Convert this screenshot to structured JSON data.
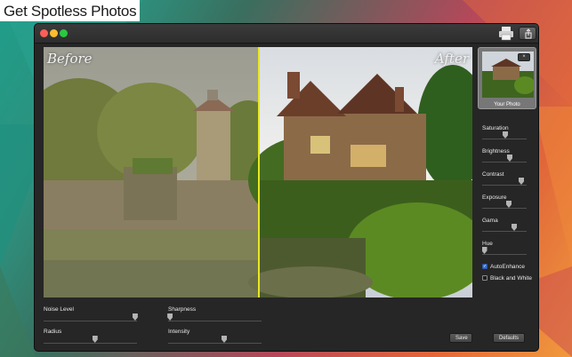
{
  "promo": {
    "headline": "Get Spotless Photos"
  },
  "toolbar": {
    "print_icon": "printer-icon",
    "share_icon": "share-icon"
  },
  "preview": {
    "before_label": "Before",
    "after_label": "After",
    "split_color": "#e6e822"
  },
  "thumbnail": {
    "caption": "Your Photo",
    "close_label": "×"
  },
  "adjustments": [
    {
      "label": "Saturation",
      "level": 0.52
    },
    {
      "label": "Brightness",
      "level": 0.62
    },
    {
      "label": "Contrast",
      "level": 0.88
    },
    {
      "label": "Exposure",
      "level": 0.6
    },
    {
      "label": "Gama",
      "level": 0.72
    },
    {
      "label": "Hue",
      "level": 0.05
    }
  ],
  "options": {
    "auto_enhance": {
      "label": "AutoEnhance",
      "checked": true
    },
    "black_white": {
      "label": "Black and White",
      "checked": false
    }
  },
  "bottom_sliders": {
    "noise": {
      "label": "Noise Level",
      "level": 0.98
    },
    "radius": {
      "label": "Radius",
      "level": 0.55
    },
    "sharpness": {
      "label": "Sharpness",
      "level": 0.02
    },
    "intensity": {
      "label": "Intensity",
      "level": 0.6
    }
  },
  "buttons": {
    "save": "Save",
    "defaults": "Defaults"
  },
  "colors": {
    "accent_blue": "#3b6fd1",
    "window_bg": "#262626"
  }
}
